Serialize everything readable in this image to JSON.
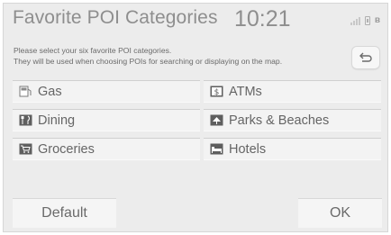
{
  "header": {
    "title": "Favorite POI Categories",
    "clock": "10:21",
    "icons": [
      "signal-icon",
      "phone-icon",
      "bluetooth-icon"
    ],
    "bluetooth_glyph": "ʙ"
  },
  "instructions": {
    "line1": "Please select your six favorite POI categories.",
    "line2": "They will be used when choosing POIs for searching or displaying on the map."
  },
  "back_button": {
    "icon": "back-arrow-icon"
  },
  "categories": [
    {
      "label": "Gas",
      "icon": "gas-pump-icon"
    },
    {
      "label": "ATMs",
      "icon": "dollar-sign-icon"
    },
    {
      "label": "Dining",
      "icon": "fork-knife-icon"
    },
    {
      "label": "Parks & Beaches",
      "icon": "park-icon"
    },
    {
      "label": "Groceries",
      "icon": "grocery-cart-icon"
    },
    {
      "label": "Hotels",
      "icon": "bed-icon"
    }
  ],
  "footer": {
    "default_label": "Default",
    "ok_label": "OK"
  }
}
